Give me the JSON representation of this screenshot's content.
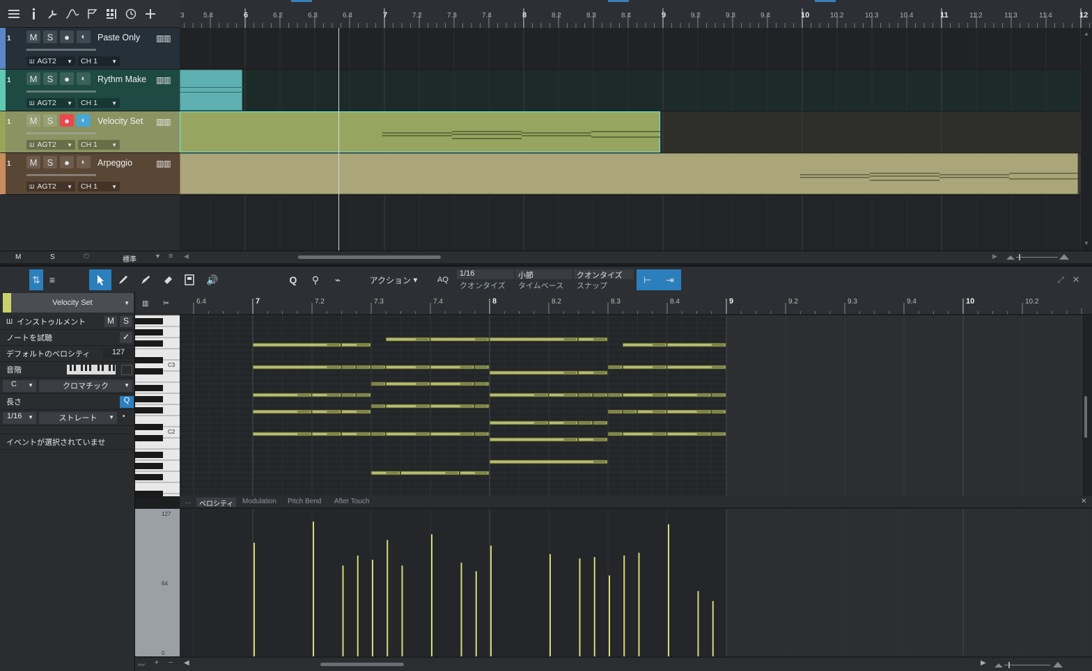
{
  "arrange_ruler": {
    "labels": [
      "5.4",
      "6",
      "6.2",
      "6.3",
      "6.4",
      "7",
      "7.2",
      "7.3",
      "7.4",
      "8",
      "8.2",
      "8.3",
      "8.4",
      "9",
      "9.2",
      "9.3",
      "9.4",
      "10",
      "10.2",
      "10.3",
      "10.4",
      "11",
      "11.2",
      "11.3",
      "11.4",
      "12"
    ],
    "partial": "3"
  },
  "tracks": [
    {
      "num": "1",
      "name": "Paste Only",
      "m": "M",
      "s": "S",
      "instrument": "AGT2",
      "channel": "CH 1",
      "color": "#5b86c8"
    },
    {
      "num": "1",
      "name": "Rythm Make",
      "m": "M",
      "s": "S",
      "instrument": "AGT2",
      "channel": "CH 1",
      "color": "#5fc9b3"
    },
    {
      "num": "1",
      "name": "Velocity Set",
      "m": "M",
      "s": "S",
      "instrument": "AGT2",
      "channel": "CH 1",
      "color": "#9aa55a"
    },
    {
      "num": "1",
      "name": "Arpeggio",
      "m": "M",
      "s": "S",
      "instrument": "AGT2",
      "channel": "CH 1",
      "color": "#c98d5f"
    }
  ],
  "top_footer": {
    "m": "M",
    "s": "S",
    "mode": "標準"
  },
  "editor_toolbar": {
    "action": "アクション",
    "aq": "AQ",
    "quantize_value": "1/16",
    "quantize_label": "クオンタイズ",
    "timebase_value": "小節",
    "timebase_label": "タイムベース",
    "snap_value": "クオンタイズ",
    "snap_label": "スナップ"
  },
  "inspector": {
    "track_name": "Velocity Set",
    "instrument": "インストゥルメント",
    "m": "M",
    "s": "S",
    "preview": "ノートを試聴",
    "default_velocity_label": "デフォルトのベロシティ",
    "default_velocity": "127",
    "scale": "音階",
    "key": "C",
    "scale_type": "クロマチック",
    "length": "長さ",
    "length_value": "1/16",
    "length_mode": "ストレート",
    "selection": "イベントが選択されていませ",
    "q": "Q"
  },
  "editor_ruler": {
    "labels": [
      "6.4",
      "7",
      "7.2",
      "7.3",
      "7.4",
      "8",
      "8.2",
      "8.3",
      "8.4",
      "9",
      "9.2",
      "9.3",
      "9.4",
      "10",
      "10.2"
    ]
  },
  "piano": {
    "c3": "C3",
    "c2": "C2"
  },
  "automation_tabs": [
    "...",
    "ベロシティ",
    "Modulation",
    "Pitch Bend",
    "After Touch"
  ],
  "velocity_axis": {
    "max": "127",
    "mid": "64",
    "min": "0"
  },
  "velocities": [
    {
      "pos": 7.0,
      "value": 0.8
    },
    {
      "pos": 7.25,
      "value": 0.95
    },
    {
      "pos": 7.375,
      "value": 0.64
    },
    {
      "pos": 7.4375,
      "value": 0.71
    },
    {
      "pos": 7.5,
      "value": 0.68
    },
    {
      "pos": 7.5625,
      "value": 0.82
    },
    {
      "pos": 7.625,
      "value": 0.64
    },
    {
      "pos": 7.75,
      "value": 0.86
    },
    {
      "pos": 7.875,
      "value": 0.66
    },
    {
      "pos": 7.9375,
      "value": 0.6
    },
    {
      "pos": 8.0,
      "value": 0.78
    },
    {
      "pos": 8.25,
      "value": 0.72
    },
    {
      "pos": 8.375,
      "value": 0.69
    },
    {
      "pos": 8.4375,
      "value": 0.7
    },
    {
      "pos": 8.5,
      "value": 0.57
    },
    {
      "pos": 8.5625,
      "value": 0.71
    },
    {
      "pos": 8.625,
      "value": 0.73
    },
    {
      "pos": 8.75,
      "value": 0.93
    },
    {
      "pos": 8.875,
      "value": 0.46
    },
    {
      "pos": 8.9375,
      "value": 0.39
    }
  ]
}
